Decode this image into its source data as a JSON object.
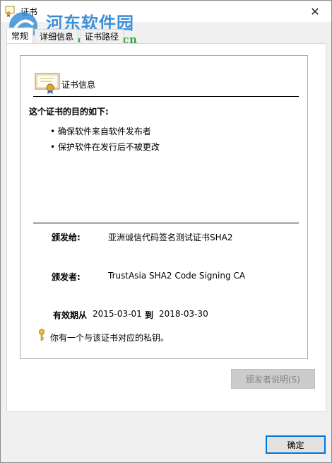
{
  "window": {
    "title": "证书",
    "close_glyph": "✕"
  },
  "watermark": {
    "site_name": "河东软件园",
    "url": "www.pc0359.cn"
  },
  "tabs": [
    {
      "label": "常规",
      "active": true
    },
    {
      "label": "详细信息",
      "active": false
    },
    {
      "label": "证书路径",
      "active": false
    }
  ],
  "certificate": {
    "section_title": "证书信息",
    "purpose_heading": "这个证书的目的如下:",
    "purposes": [
      "确保软件来自软件发布者",
      "保护软件在发行后不被更改"
    ],
    "issued_to_label": "颁发给:",
    "issued_to_value": "亚洲诚信代码签名测试证书SHA2",
    "issued_by_label": "颁发者:",
    "issued_by_value": "TrustAsia SHA2 Code Signing CA",
    "validity_label": "有效期从",
    "valid_from": "2015-03-01",
    "validity_to_label": "到",
    "valid_to": "2018-03-30",
    "private_key_note": "你有一个与该证书对应的私钥。"
  },
  "buttons": {
    "issuer_statement": "颁发者说明(S)",
    "ok": "确定"
  },
  "colors": {
    "accent": "#0078d7",
    "watermark_title": "#3a8fd8",
    "watermark_url": "#3aa04a",
    "disabled_button": "#cccccc"
  }
}
